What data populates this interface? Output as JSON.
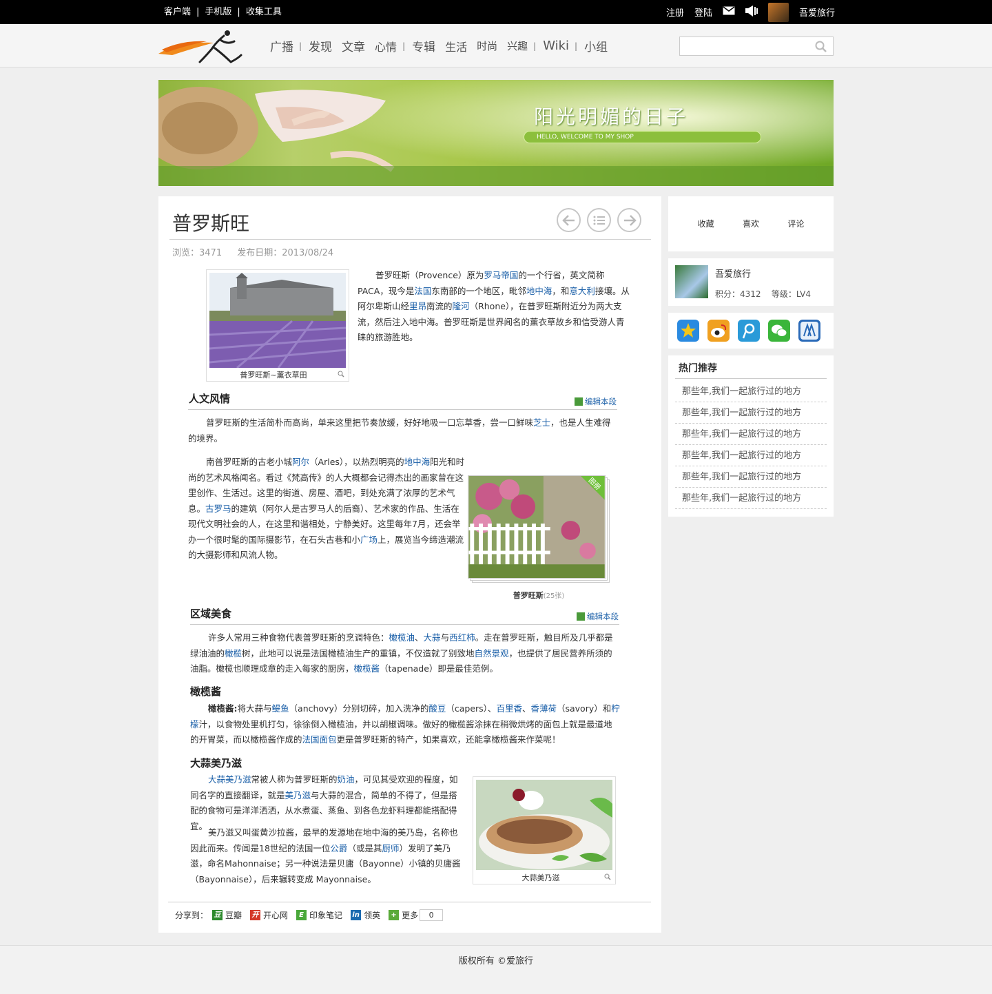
{
  "topbar": {
    "left_links": [
      "客户端",
      "手机版",
      "收集工具"
    ],
    "register": "注册",
    "login": "登陆",
    "username": "吾爱旅行"
  },
  "nav": {
    "items": [
      "广播",
      "发现",
      "文章",
      "心情",
      "专辑",
      "生活",
      "时尚",
      "兴趣",
      "Wiki",
      "小组"
    ],
    "search_placeholder": ""
  },
  "banner": {
    "title": "阳光明媚的日子",
    "subtitle": "HELLO, WELCOME TO MY SHOP"
  },
  "article": {
    "title": "普罗斯旺",
    "views": "浏览：3471",
    "date": "发布日期：2013/08/24",
    "figure1_caption": "普罗旺斯~薰衣草田",
    "intro": [
      "普罗旺斯（Provence）原为",
      "罗马帝国",
      "的一个行省，英文简称PACA，现今是",
      "法国",
      "东南部的一个地区，毗邻",
      "地中海",
      "，和",
      "意大利",
      "接壤。从阿尔卑斯山经",
      "里昂",
      "南流的",
      "隆河",
      "（Rhone），在普罗旺斯附近分为两大支流，然后注入地中海。普罗旺斯是世界闻名的薰衣草故乡和信受游人青睐的旅游胜地。"
    ],
    "sec1_title": "人文风情",
    "edit_label": "编辑本段",
    "sec1_p1": [
      "普罗旺斯的生活简朴而高尚，单来这里把节奏放缓，好好地吸一口忘草香，尝一口鲜味",
      "芝士",
      "，也是人生难得的境界。"
    ],
    "sec1_p2": [
      "南普罗旺斯的古老小城",
      "阿尔",
      "（Arles），以热烈明亮的",
      "地中海",
      "阳光和时尚的艺术风格闻名。看过《梵高传》的人大概都会记得杰出的画家曾在这里创作、生活过。这里的街道、房屋、酒吧，到处充满了浓厚的艺术气息。",
      "古罗马",
      "的建筑（阿尔人是古罗马人的后裔）、艺术家的作品、生活在现代文明社会的人，在这里和谐相处，宁静美好。这里每年7月，还会举办一个很时髦的国际摄影节，在石头古巷和小",
      "广场",
      "上，展览当今缔造潮流的大摄影师和风流人物。"
    ],
    "album_badge": "图册",
    "album_caption": "普罗旺斯",
    "album_count": "(25张)",
    "sec2_title": "区域美食",
    "sec2_p1": [
      "许多人常用三种食物代表普罗旺斯的烹调特色：",
      "橄榄油",
      "、",
      "大蒜",
      "与",
      "西红柿",
      "。走在普罗旺斯，触目所及几乎都是绿油油的",
      "橄榄",
      "树，此地可以说是法国橄榄油生产的重镇，不仅造就了别致地",
      "自然景观",
      "，也提供了居民营养所须的油脂。橄榄也顺理成章的走入每家的厨房，",
      "橄榄酱",
      "（tapenade）即是最佳范例。"
    ],
    "sec3_title": "橄榄酱",
    "sec3_p1": [
      "橄榄酱:",
      "将大蒜与",
      "鳀鱼",
      "（anchovy）分别切碎，加入洗净的",
      "酸豆",
      "（capers）、",
      "百里香",
      "、",
      "香薄荷",
      "（savory）和",
      "柠檬",
      "汁，以食物处里机打匀，徐徐倒入橄榄油，并以胡椒调味。做好的橄榄酱涂抹在稍微烘烤的面包上就是最道地的开胃菜，而以橄榄酱作成的",
      "法国面包",
      "更是普罗旺斯的特产，如果喜欢，还能拿橄榄酱来作菜呢！"
    ],
    "sec4_title": "大蒜美乃滋",
    "sec4_p1": [
      "大蒜美乃滋",
      "常被人称为普罗旺斯的",
      "奶油",
      "，可见其受欢迎的程度，如同名字的直接翻译，就是",
      "美乃滋",
      "与大蒜的混合，简单的不得了，但是搭配的食物可是洋洋洒洒，从水煮蛋、蒸鱼、到各色龙虾料理都能搭配得宜。"
    ],
    "sec4_p2": [
      "美乃滋又叫蛋黄沙拉酱，最早的发源地在地中海的美乃岛，名称也因此而来。传闻是18世纪的法国一位",
      "公爵",
      "（或是其",
      "厨师",
      "）发明了美乃滋，命名Mahonnaise；另一种说法是贝庸（Bayonne）小镇的贝庸酱（Bayonnaise），后来辗转变成 Mayonnaise。"
    ],
    "figure3_caption": "大蒜美乃滋",
    "share_label": "分享到：",
    "share": [
      "豆瓣",
      "开心网",
      "印象笔记",
      "领英",
      "更多"
    ],
    "share_count": "0"
  },
  "sidebar": {
    "actions": [
      "收藏",
      "喜欢",
      "评论"
    ],
    "user_name": "吾爱旅行",
    "user_points": "积分：4312",
    "user_level": "等级：LV4",
    "hot_title": "热门推荐",
    "hot_items": [
      "那些年,我们一起旅行过的地方",
      "那些年,我们一起旅行过的地方",
      "那些年,我们一起旅行过的地方",
      "那些年,我们一起旅行过的地方",
      "那些年,我们一起旅行过的地方",
      "那些年,我们一起旅行过的地方"
    ]
  },
  "footer": {
    "copyright": "版权所有 ©爱旅行"
  },
  "colors": {
    "link": "#1a5fa8",
    "topbar": "#000000",
    "page_bg": "#efefef"
  }
}
